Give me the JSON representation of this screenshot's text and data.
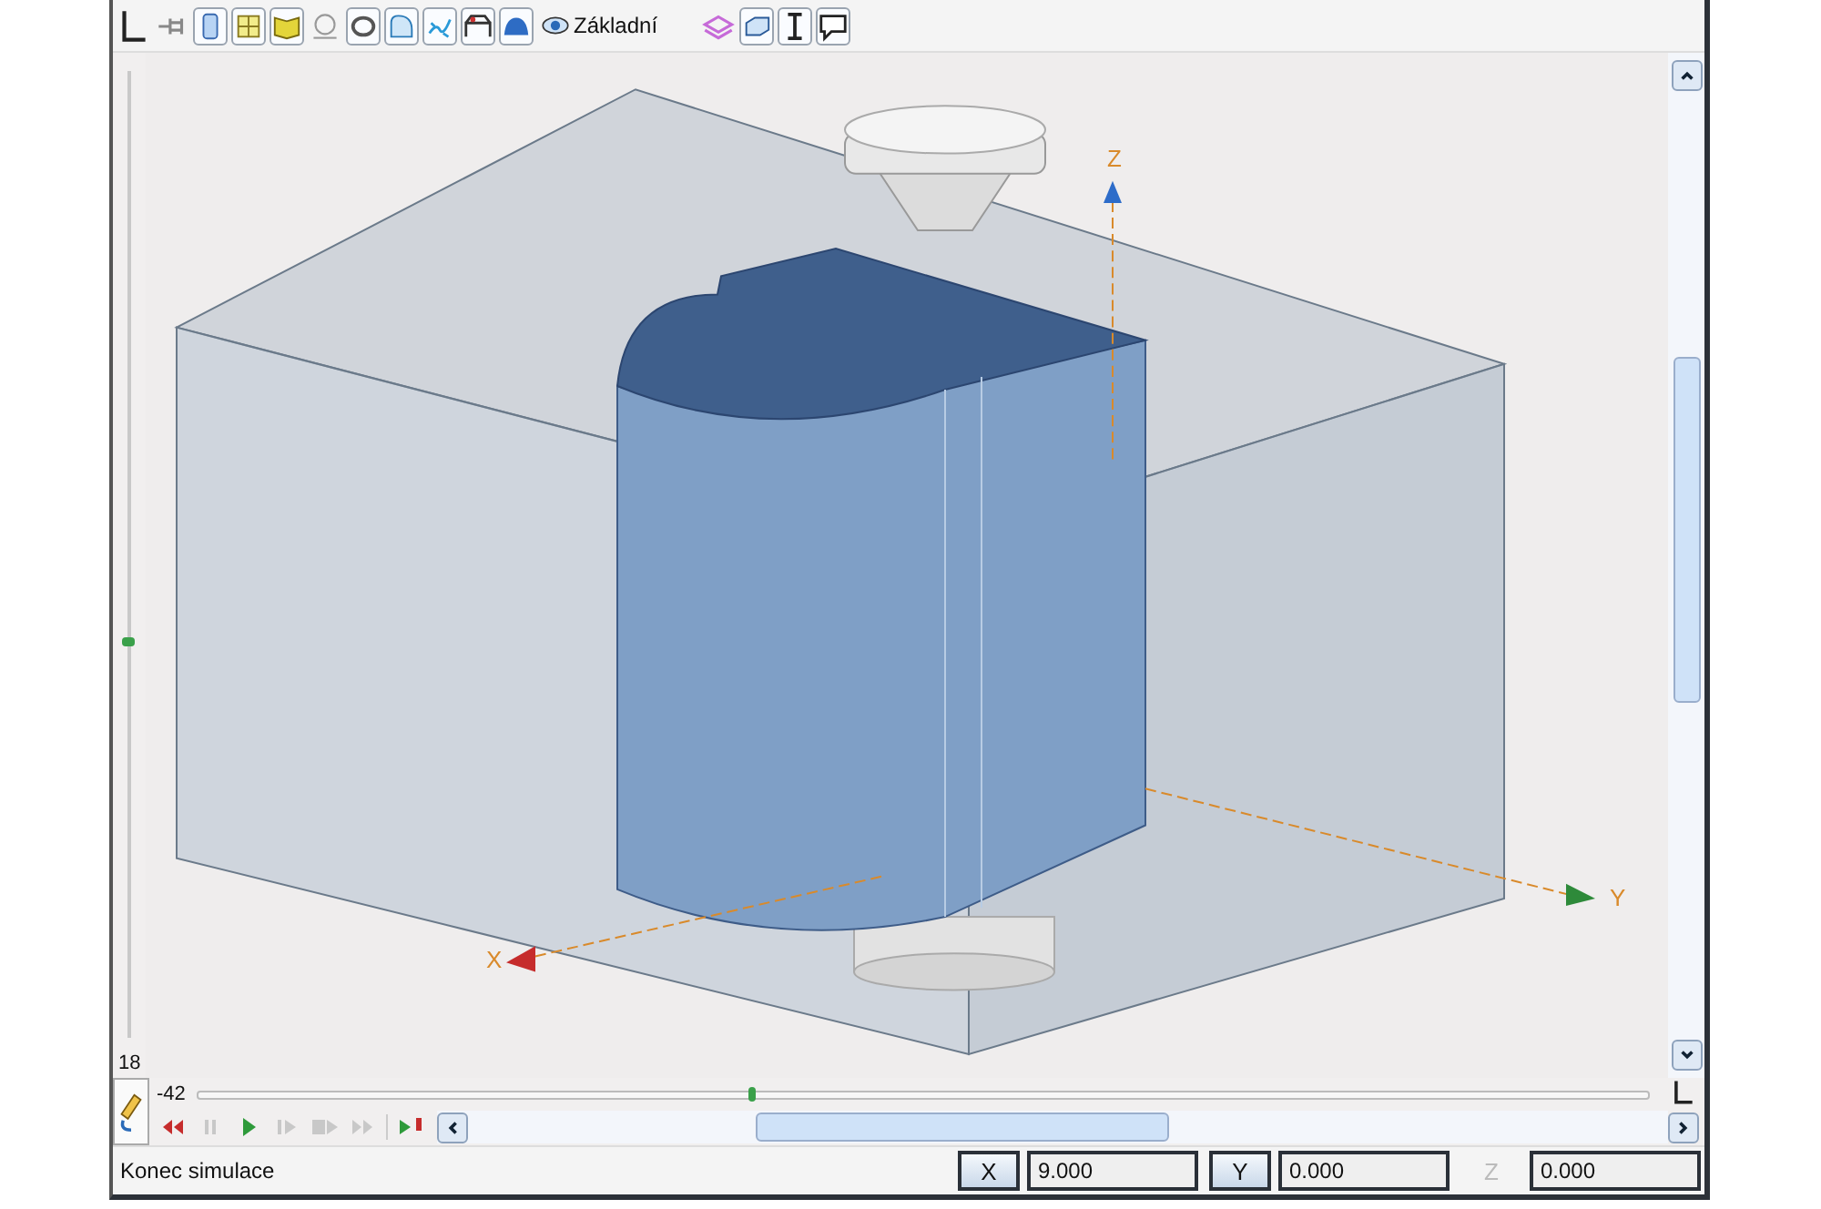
{
  "toolbar": {
    "view_label": "Základní"
  },
  "viewport": {
    "axes": [
      {
        "kind": "z",
        "label": "Z"
      },
      {
        "kind": "y",
        "label": "Y"
      },
      {
        "kind": "x",
        "label": "X"
      }
    ]
  },
  "depth_slider": {
    "reading": "18",
    "level": 0.41
  },
  "position_slider": {
    "reading": "-42",
    "level": 0.38
  },
  "playback": [
    {
      "kind": "rewind",
      "disabled": false
    },
    {
      "kind": "pause",
      "disabled": true
    },
    {
      "kind": "play",
      "disabled": false
    },
    {
      "kind": "step",
      "disabled": true
    },
    {
      "kind": "step-block",
      "disabled": true
    },
    {
      "kind": "fast-forward",
      "disabled": true
    },
    {
      "kind": "run-to-stop",
      "disabled": false
    }
  ],
  "status_bar": {
    "message": "Konec simulace",
    "coordinates": [
      {
        "label": "X",
        "value": "9.000",
        "disabled": false
      },
      {
        "label": "Y",
        "value": "0.000",
        "disabled": false
      },
      {
        "label": "Z",
        "value": "0.000",
        "disabled": true
      }
    ]
  }
}
